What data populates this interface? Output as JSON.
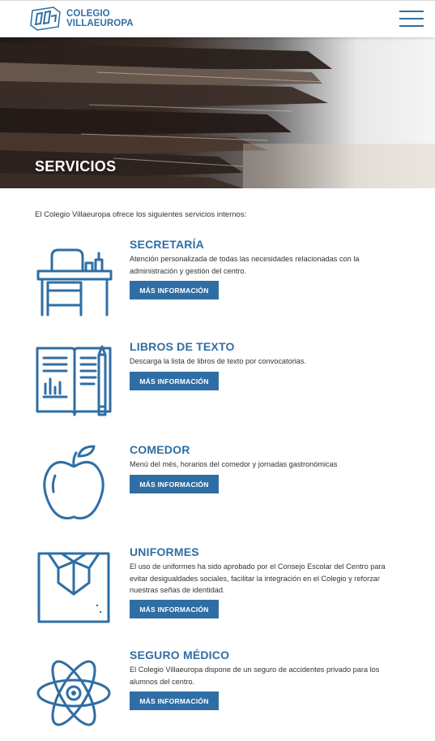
{
  "header": {
    "logo_line1": "COLEGIO",
    "logo_line2": "VILLAEUROPA",
    "menu_icon": "hamburger-menu-icon"
  },
  "hero": {
    "title": "SERVICIOS"
  },
  "intro": "El Colegio Villaeuropa ofrece los siguientes servicios internos:",
  "services": [
    {
      "title": "SECRETARÍA",
      "description": "Atención personalizada de todas las necesidades relacionadas con la administración y gestión del centro.",
      "button": "MÁS INFORMACIÓN",
      "icon": "desk-icon"
    },
    {
      "title": "LIBROS DE TEXTO",
      "description": "Descarga la lista de libros de texto por convocatorias.",
      "button": "MÁS INFORMACIÓN",
      "icon": "book-pencil-icon"
    },
    {
      "title": "COMEDOR",
      "description": "Menú del més, horarios del comedor y jornadas gastronómicas",
      "button": "MÁS INFORMACIÓN",
      "icon": "apple-icon"
    },
    {
      "title": "UNIFORMES",
      "description": "El uso de uniformes ha sido aprobado por el Consejo Escolar del Centro para evitar desigualdades sociales, facilitar la integración en el Colegio y reforzar nuestras señas de identidad.",
      "button": "MÁS INFORMACIÓN",
      "icon": "folded-shirt-icon"
    },
    {
      "title": "SEGURO MÉDICO",
      "description": "El Colegio Villaeuropa dispone de un seguro de accidentes privado para los alumnos del centro.",
      "button": "MÁS INFORMACIÓN",
      "icon": "atom-icon"
    }
  ],
  "colors": {
    "accent": "#2f6ea4",
    "text": "#333333",
    "background": "#ffffff"
  }
}
